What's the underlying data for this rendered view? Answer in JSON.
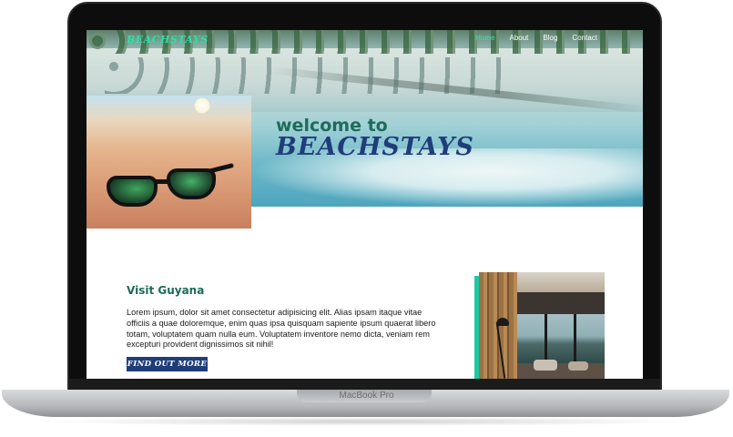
{
  "device": {
    "label": "MacBook Pro"
  },
  "site": {
    "logo": "BEACHSTAYS",
    "nav": [
      {
        "label": "Home",
        "active": true
      },
      {
        "label": "About",
        "active": false
      },
      {
        "label": "Blog",
        "active": false
      },
      {
        "label": "Contact",
        "active": false
      }
    ],
    "hero": {
      "welcome": "welcome to",
      "wordmark": "BEACHSTAYS"
    },
    "section": {
      "title": "Visit Guyana",
      "body": "Lorem ipsum, dolor sit amet consectetur adipisicing elit. Alias ipsam itaque vitae officiis a quae doloremque, enim quas ipsa quisquam sapiente ipsum quaerat libero totam, voluptatem quam nulla eum. Voluptatem inventore nemo dicta, veniam rem excepturi provident dignissimos sit nihil!",
      "cta_label": "FIND OUT MORE"
    }
  },
  "colors": {
    "accent": "#33e3b0",
    "brand_navy": "#1f3d7a",
    "heading_green": "#1c6a58"
  }
}
